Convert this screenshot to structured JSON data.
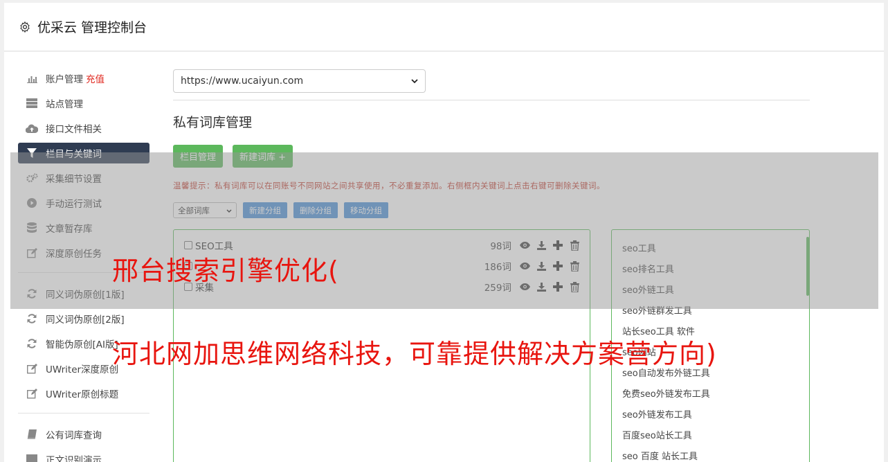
{
  "header": {
    "title": "优采云 管理控制台"
  },
  "sidebar": {
    "items": [
      {
        "label": "账户管理",
        "badge": "充值",
        "icon": "bar-chart-icon"
      },
      {
        "label": "站点管理",
        "icon": "server-icon"
      },
      {
        "label": "接口文件相关",
        "icon": "cloud-upload-icon"
      },
      {
        "label": "栏目与关键词",
        "icon": "filter-icon",
        "active": true
      },
      {
        "label": "采集细节设置",
        "icon": "gears-icon"
      },
      {
        "label": "手动运行测试",
        "icon": "play-circle-icon"
      },
      {
        "label": "文章暂存库",
        "icon": "database-icon"
      },
      {
        "label": "深度原创任务",
        "icon": "edit-icon"
      },
      {
        "label": "同义词伪原创[1版]",
        "icon": "refresh-icon"
      },
      {
        "label": "同义词伪原创[2版]",
        "icon": "refresh-icon"
      },
      {
        "label": "智能伪原创[AI版]",
        "icon": "refresh-icon"
      },
      {
        "label": "UWriter深度原创",
        "icon": "edit-icon"
      },
      {
        "label": "UWriter原创标题",
        "icon": "edit-icon"
      },
      {
        "label": "公有词库查询",
        "icon": "book-icon"
      },
      {
        "label": "正文识别演示",
        "icon": "monitor-icon"
      }
    ]
  },
  "site_select": {
    "value": "https://www.ucaiyun.com"
  },
  "page_heading": "私有词库管理",
  "buttons": {
    "column_manage": "栏目管理",
    "new_library": "新建词库 +"
  },
  "tip": "温馨提示：私有词库可以在同账号不同网站之间共享使用，不必重复添加。右侧框内关键词上点击右键可删除关键词。",
  "group_filter": {
    "value": "全部词库"
  },
  "group_buttons": {
    "new_group": "新建分组",
    "delete_group": "删除分组",
    "move_group": "移动分组"
  },
  "libraries": [
    {
      "name": "SEO工具",
      "count": "98词"
    },
    {
      "name": "",
      "count": "186词"
    },
    {
      "name": "采集",
      "count": "259词"
    }
  ],
  "keywords": [
    "seo工具",
    "seo排名工具",
    "seo外链工具",
    "seo外链群发工具",
    "站长seo工具 软件",
    "seo网站",
    "seo自动发布外链工具",
    "免费seo外链发布工具",
    "seo外链发布工具",
    "百度seo站长工具",
    "seo 百度 站长工具"
  ],
  "watermark": {
    "line1": "邢台搜索引擎优化(",
    "line2": "河北网加思维网络科技，可靠提供解决方案营方向)"
  }
}
